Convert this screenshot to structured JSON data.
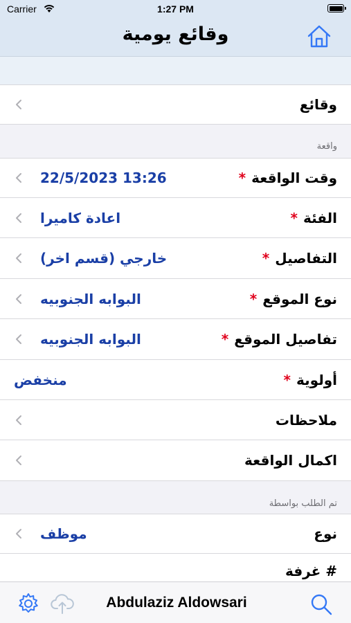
{
  "status_bar": {
    "carrier": "Carrier",
    "time": "1:27 PM"
  },
  "nav": {
    "title": "وقائع يومية"
  },
  "rows": {
    "incidents": {
      "label": "وقائع"
    },
    "incident_time": {
      "label": "وقت الواقعة",
      "value": "22/5/2023 13:26"
    },
    "category": {
      "label": "الفئة",
      "value": "اعادة كاميرا"
    },
    "details": {
      "label": "التفاصيل",
      "value": "خارجي (قسم اخر)"
    },
    "location_type": {
      "label": "نوع الموقع",
      "value": "البوابه الجنوبيه"
    },
    "location_details": {
      "label": "تفاصيل الموقع",
      "value": "البوابه الجنوبيه"
    },
    "priority": {
      "label": "أولوية",
      "value": "منخفض"
    },
    "notes": {
      "label": "ملاحظات"
    },
    "complete_incident": {
      "label": "اكمال الواقعة"
    },
    "type": {
      "label": "نوع",
      "value": "موظف"
    },
    "room": {
      "label": "# غرفة"
    }
  },
  "sections": {
    "incident": "واقعة",
    "requested_by": "تم الطلب بواسطة"
  },
  "required_marker": "*",
  "toolbar": {
    "user_name": "Abdulaziz Aldowsari"
  },
  "icons": {
    "home": "home-icon",
    "settings": "gear-icon",
    "upload": "cloud-upload-icon",
    "search": "search-icon",
    "chevron": "chevron-left-icon"
  },
  "colors": {
    "accent": "#1a3fa6",
    "required": "#e0001b",
    "icon": "#3478f6",
    "nav_bg": "#dce7f3"
  }
}
